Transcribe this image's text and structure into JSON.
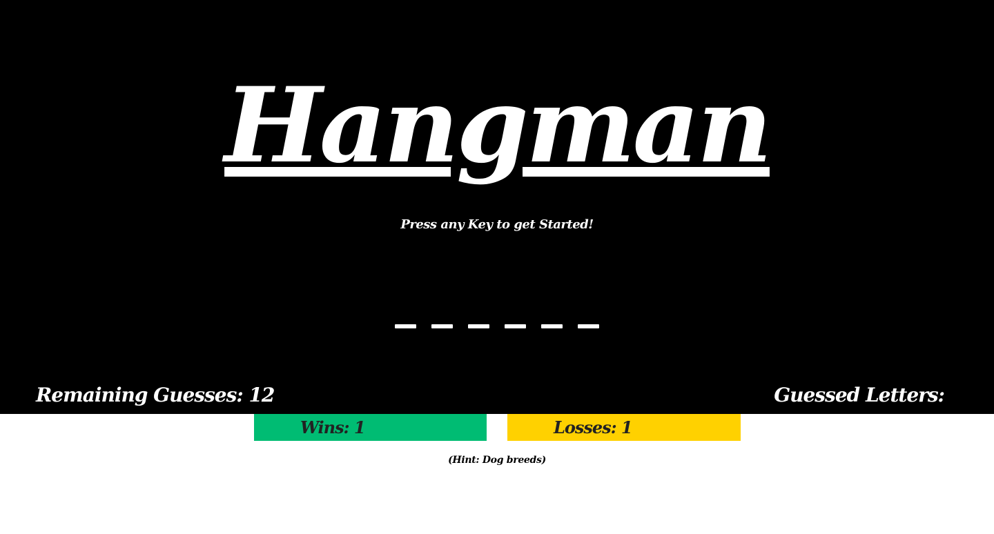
{
  "game": {
    "title": "Hangman",
    "prompt": "Press any Key to get Started!",
    "word_length": 6,
    "remaining_label": "Remaining Guesses: ",
    "remaining_value": "12",
    "guessed_label": "Guessed Letters:",
    "guessed_letters": ""
  },
  "score": {
    "wins_label": "Wins: ",
    "wins_value": "1",
    "losses_label": "Losses: ",
    "losses_value": "1"
  },
  "hint": "(Hint: Dog breeds)",
  "colors": {
    "background": "#000000",
    "text": "#ffffff",
    "wins": "#00BC73",
    "losses": "#FFD100"
  }
}
